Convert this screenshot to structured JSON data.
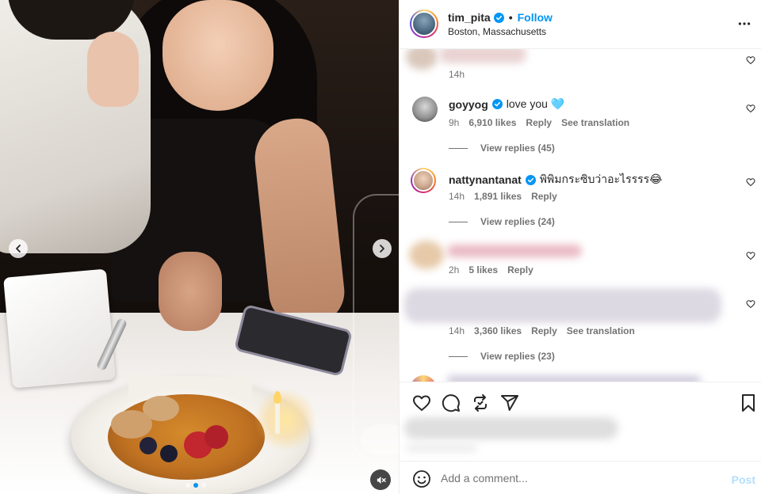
{
  "header": {
    "username": "tim_pita",
    "separator": "•",
    "follow_label": "Follow",
    "location": "Boston, Massachusetts"
  },
  "comments": [
    {
      "id": "blurred-top",
      "username": "",
      "text": "",
      "time": "14h",
      "blurred": true
    },
    {
      "id": "goyyog",
      "username": "goyyog",
      "verified": true,
      "text": "love you 🩵",
      "time": "9h",
      "likes": "6,910 likes",
      "reply_label": "Reply",
      "translation_label": "See translation",
      "view_replies": "View replies (45)"
    },
    {
      "id": "nattynantanat",
      "username": "nattynantanat",
      "verified": true,
      "text": "พิพิมกระซิบว่าอะไรรรร😂",
      "time": "14h",
      "likes": "1,891 likes",
      "reply_label": "Reply",
      "view_replies": "View replies (24)"
    },
    {
      "id": "blurred-3",
      "username": "",
      "text": "",
      "time": "2h",
      "likes": "5 likes",
      "reply_label": "Reply",
      "blurred": true
    },
    {
      "id": "blurred-4",
      "username": "",
      "text": "",
      "time": "14h",
      "likes": "3,360 likes",
      "reply_label": "Reply",
      "translation_label": "See translation",
      "view_replies": "View replies (23)",
      "blurred": true
    }
  ],
  "add_comment": {
    "placeholder": "Add a comment...",
    "post_label": "Post"
  },
  "media": {
    "carousel_dots": 3,
    "active_dot": 1
  },
  "colors": {
    "accent": "#0095f6",
    "muted": "#737373",
    "text": "#262626",
    "post_disabled": "#b2dffc"
  }
}
